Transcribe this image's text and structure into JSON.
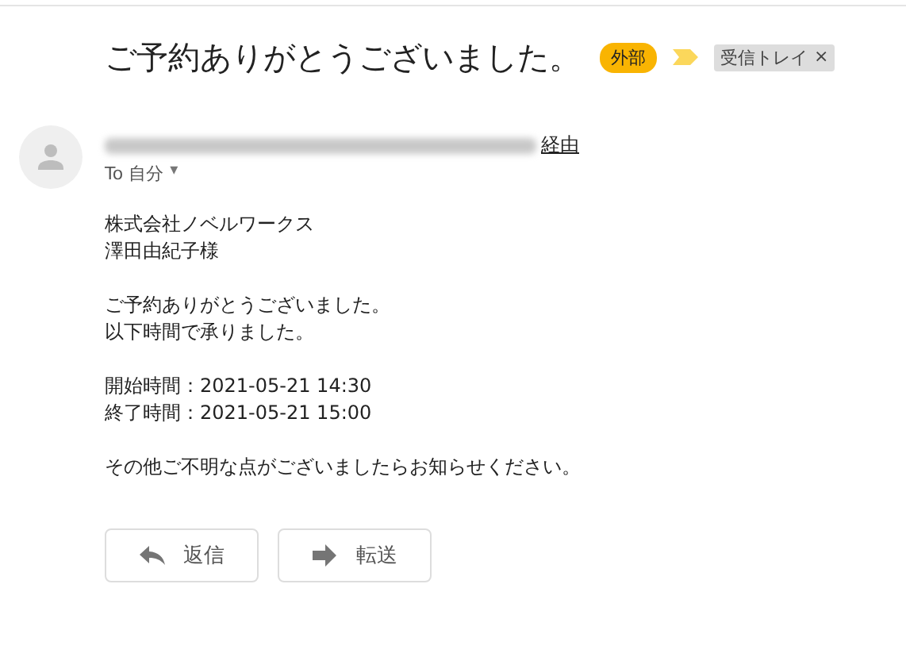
{
  "subject": "ご予約ありがとうございました。",
  "labels": [
    {
      "kind": "badge",
      "text": "外部",
      "color": "#f9b402"
    },
    {
      "kind": "importance",
      "color": "#fbd75b"
    },
    {
      "kind": "chip",
      "text": "受信トレイ",
      "close": "×"
    }
  ],
  "sender": {
    "via": "経由",
    "to": "To 自分",
    "caret": "▾"
  },
  "body": [
    [
      "株式会社ノベルワークス",
      "澤田由紀子様"
    ],
    [
      "ご予約ありがとうございました。",
      "以下時間で承りました。"
    ],
    [
      "開始時間：2021-05-21 14:30",
      "終了時間：2021-05-21 15:00"
    ],
    [
      "その他ご不明な点がございましたらお知らせください。"
    ]
  ],
  "buttons": [
    {
      "kind": "reply",
      "label": "返信"
    },
    {
      "kind": "forward",
      "label": "転送"
    }
  ]
}
